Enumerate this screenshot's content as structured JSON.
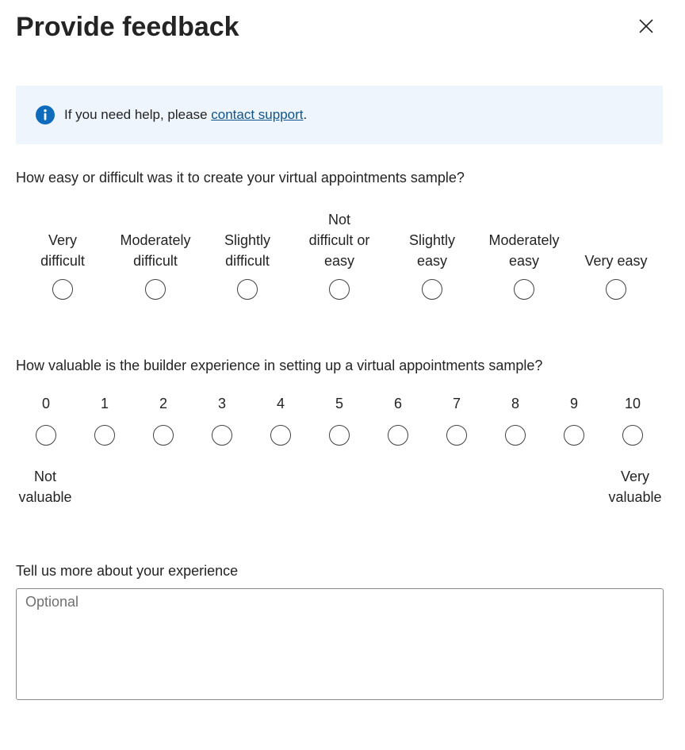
{
  "dialog": {
    "title": "Provide feedback",
    "close_icon": "close-icon"
  },
  "banner": {
    "icon": "info-icon",
    "text_before": "If you need help, please ",
    "link_text": "contact support",
    "text_after": ".",
    "accent_color": "#0f6cbd",
    "background": "#eef5fc"
  },
  "question1": {
    "text": "How easy or difficult was it to create your virtual appointments sample?",
    "options": [
      [
        "Very",
        "difficult"
      ],
      [
        "Moderately",
        "difficult"
      ],
      [
        "Slightly",
        "difficult"
      ],
      [
        "Not",
        "difficult or",
        "easy"
      ],
      [
        "Slightly",
        "easy"
      ],
      [
        "Moderately",
        "easy"
      ],
      [
        "Very easy"
      ]
    ]
  },
  "question2": {
    "text": "How valuable is the builder experience in setting up a virtual appointments sample?",
    "scale": [
      "0",
      "1",
      "2",
      "3",
      "4",
      "5",
      "6",
      "7",
      "8",
      "9",
      "10"
    ],
    "low_label": [
      "Not",
      "valuable"
    ],
    "high_label": [
      "Very",
      "valuable"
    ]
  },
  "comments": {
    "label": "Tell us more about your experience",
    "placeholder": "Optional",
    "value": ""
  }
}
